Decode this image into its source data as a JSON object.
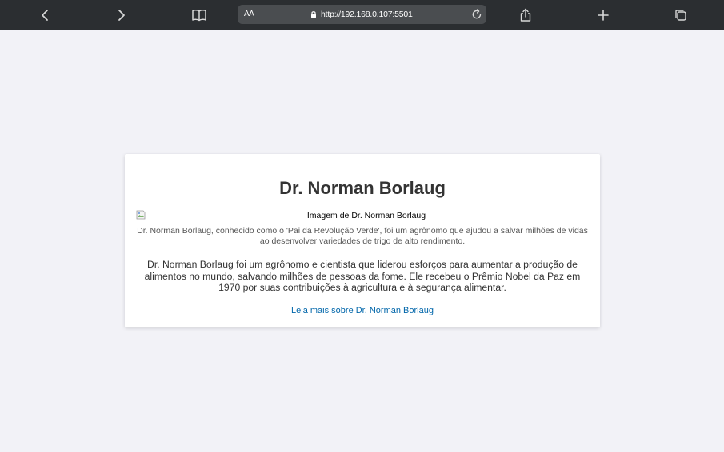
{
  "browser": {
    "reader_label": "AA",
    "url": "http://192.168.0.107:5501",
    "icons": {
      "back": "chevron-left-icon",
      "forward": "chevron-right-icon",
      "bookmarks": "book-icon",
      "lock": "lock-icon",
      "reload": "reload-icon",
      "share": "share-icon",
      "new_tab": "plus-icon",
      "tabs": "tabs-icon"
    }
  },
  "page": {
    "title": "Dr. Norman Borlaug",
    "image_alt": "Imagem de Dr. Norman Borlaug",
    "caption": "Dr. Norman Borlaug, conhecido como o 'Pai da Revolução Verde', foi um agrônomo que ajudou a salvar milhões de vidas ao desenvolver variedades de trigo de alto rendimento.",
    "body": "Dr. Norman Borlaug foi um agrônomo e cientista que liderou esforços para aumentar a produção de alimentos no mundo, salvando milhões de pessoas da fome. Ele recebeu o Prêmio Nobel da Paz em 1970 por suas contribuições à agricultura e à segurança alimentar.",
    "link_text": "Leia mais sobre Dr. Norman Borlaug"
  },
  "colors": {
    "toolbar_bg": "#2b2e31",
    "page_bg": "#f2f2f7",
    "card_bg": "#ffffff",
    "link": "#0066aa"
  }
}
